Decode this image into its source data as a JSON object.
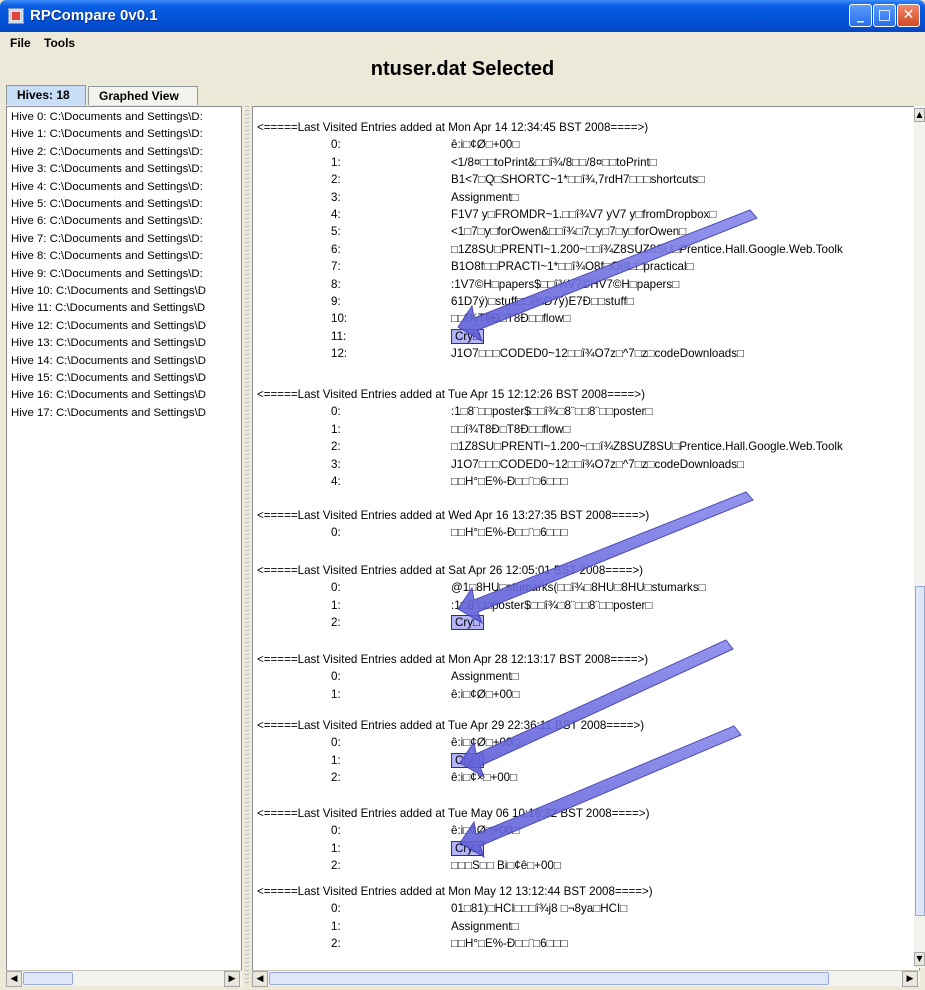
{
  "window": {
    "title": "RPCompare 0v0.1"
  },
  "menu": {
    "file": "File",
    "tools": "Tools"
  },
  "header": {
    "title": "ntuser.dat Selected"
  },
  "tabs": [
    {
      "label": "Hives: 18"
    },
    {
      "label": "Graphed View"
    }
  ],
  "hives": [
    "Hive 0: C:\\Documents and Settings\\D:",
    "Hive 1: C:\\Documents and Settings\\D:",
    "Hive 2: C:\\Documents and Settings\\D:",
    "Hive 3: C:\\Documents and Settings\\D:",
    "Hive 4: C:\\Documents and Settings\\D:",
    "Hive 5: C:\\Documents and Settings\\D:",
    "Hive 6: C:\\Documents and Settings\\D:",
    "Hive 7: C:\\Documents and Settings\\D:",
    "Hive 8: C:\\Documents and Settings\\D:",
    "Hive 9: C:\\Documents and Settings\\D:",
    "Hive 10: C:\\Documents and Settings\\D",
    "Hive 11: C:\\Documents and Settings\\D",
    "Hive 12: C:\\Documents and Settings\\D",
    "Hive 13: C:\\Documents and Settings\\D",
    "Hive 14: C:\\Documents and Settings\\D",
    "Hive 15: C:\\Documents and Settings\\D",
    "Hive 16: C:\\Documents and Settings\\D",
    "Hive 17: C:\\Documents and Settings\\D"
  ],
  "sections": [
    {
      "header": "<=====Last Visited  Entries added at Mon Apr 14 12:34:45 BST 2008====>)",
      "entries": [
        {
          "idx": "0:",
          "val": "ê:i□¢Ø□+00□"
        },
        {
          "idx": "1:",
          "val": "<1/8¤□□toPrint&□□î¾/8□□/8¤□□toPrint□"
        },
        {
          "idx": "2:",
          "val": "B1<7□Q□SHORTC~1*□□î¾,7rdH7□□□shortcuts□"
        },
        {
          "idx": "3:",
          "val": "Assignment□"
        },
        {
          "idx": "4:",
          "val": "F1V7 y□FROMDR~1.□□î¾V7 yV7 y□fromDropbox□"
        },
        {
          "idx": "5:",
          "val": "<1□7□y□forOwen&□□î¾□7□y□7□y□forOwen□"
        },
        {
          "idx": "6:",
          "val": "□1Z8SU□PRENTI~1.200~□□î¾Z8SUZ8SU□Prentice.Hall.Google.Web.Toolk"
        },
        {
          "idx": "7:",
          "val": "B1O8f□□PRACTI~1*□□î¾O8f□O8f□□practical□"
        },
        {
          "idx": "8:",
          "val": ":1V7©H□papers$□□î¾V7©HV7©H□papers□"
        },
        {
          "idx": "9:",
          "val": "61D7ý)□stuff□□î¾D7ý)E7Ð□□stuff□"
        },
        {
          "idx": "10:",
          "val": "□□î¾T8Ð□T8Ð□□flow□"
        },
        {
          "idx": "11:",
          "val": "Cry□",
          "hl": true
        },
        {
          "idx": "12:",
          "val": "J1O7□□□CODED0~12□□î¾O7z□^7□z□codeDownloads□"
        }
      ]
    },
    {
      "header": "<=====Last Visited  Entries added at Tue Apr 15 12:12:26 BST 2008====>)",
      "entries": [
        {
          "idx": "0:",
          "val": ":1□8¨□□poster$□□î¾□8¨□□8¨□□poster□"
        },
        {
          "idx": "1:",
          "val": "□□î¾T8Ð□T8Ð□□flow□"
        },
        {
          "idx": "2:",
          "val": "□1Z8SU□PRENTI~1.200~□□î¾Z8SUZ8SU□Prentice.Hall.Google.Web.Toolk"
        },
        {
          "idx": "3:",
          "val": "J1O7□□□CODED0~12□□î¾O7z□^7□z□codeDownloads□"
        },
        {
          "idx": "4:",
          "val": "□□H°□E%-Ð□□¨□6□□□"
        }
      ]
    },
    {
      "header": "<=====Last Visited  Entries added at Wed Apr 16 13:27:35 BST 2008====>)",
      "entries": [
        {
          "idx": "0:",
          "val": "□□H°□E%-Ð□□¨□6□□□"
        }
      ]
    },
    {
      "header": "<=====Last Visited  Entries added at Sat Apr 26 12:05:01 BST 2008====>)",
      "entries": [
        {
          "idx": "0:",
          "val": "@1□8HU□stumarks(□□î¾□8HU□8HU□stumarks□"
        },
        {
          "idx": "1:",
          "val": ":1□8¨□□poster$□□î¾□8¨□□8¨□□poster□"
        },
        {
          "idx": "2:",
          "val": "Cry□",
          "hl": true
        }
      ]
    },
    {
      "header": "<=====Last Visited  Entries added at Mon Apr 28 12:13:17 BST 2008====>)",
      "entries": [
        {
          "idx": "0:",
          "val": "Assignment□"
        },
        {
          "idx": "1:",
          "val": "ê:i□¢Ø□+00□"
        }
      ]
    },
    {
      "header": "<=====Last Visited  Entries added at Tue Apr 29 22:36:11 BST 2008====>)",
      "entries": [
        {
          "idx": "0:",
          "val": "ê:i□¢Ø□+00□"
        },
        {
          "idx": "1:",
          "val": "Cry□",
          "hl": true
        },
        {
          "idx": "2:",
          "val": "ê:i□¢×□+00□"
        }
      ]
    },
    {
      "header": "<=====Last Visited  Entries added at Tue May 06 10:16:32 BST 2008====>)",
      "entries": [
        {
          "idx": "0:",
          "val": "ê:i□¢Ø□+00□"
        },
        {
          "idx": "1:",
          "val": "Cry□",
          "hl": true
        },
        {
          "idx": "2:",
          "val": "□□□S□□ Bi□¢ê□+00□"
        }
      ]
    },
    {
      "header": "<=====Last Visited  Entries added at Mon May 12 13:12:44 BST 2008====>)",
      "entries": [
        {
          "idx": "0:",
          "val": "01□81)□HCI□□□î¾j8          □¬8ya□HCI□"
        },
        {
          "idx": "1:",
          "val": "Assignment□"
        },
        {
          "idx": "2:",
          "val": "□□H°□E%-Ð□□¨□6□□□"
        }
      ]
    }
  ]
}
